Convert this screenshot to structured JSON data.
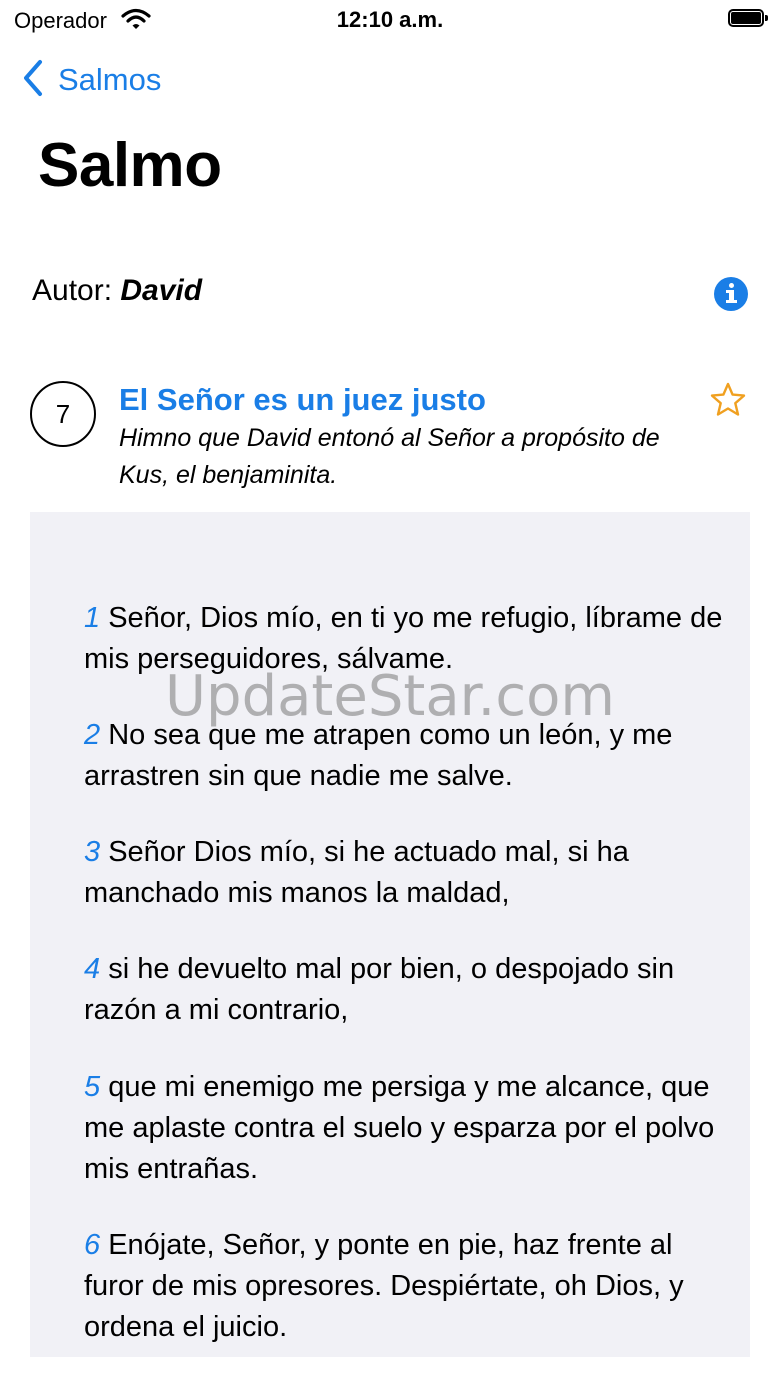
{
  "status_bar": {
    "carrier": "Operador",
    "time": "12:10 a.m."
  },
  "nav": {
    "back_label": "Salmos",
    "title": "Salmo"
  },
  "author": {
    "label": "Autor:",
    "name": "David"
  },
  "psalm": {
    "number": "7",
    "title": "El Señor es un juez justo",
    "subtitle": "Himno que David entonó al Señor a propósito de Kus, el benjaminita."
  },
  "verses": [
    {
      "num": "1",
      "text": "Señor, Dios mío, en ti yo me refugio, líbrame de mis perseguidores, sálvame."
    },
    {
      "num": "2",
      "text": "No sea que me atrapen como un león, y me arrastren sin que nadie me salve."
    },
    {
      "num": "3",
      "text": "Señor Dios mío, si he actuado mal, si ha manchado mis manos la maldad,"
    },
    {
      "num": "4",
      "text": "si he devuelto mal por bien, o despojado sin razón a mi contrario,"
    },
    {
      "num": "5",
      "text": "que mi enemigo me persiga y me alcance, que me aplaste contra el suelo y esparza por el polvo mis entrañas."
    },
    {
      "num": "6",
      "text": "Enójate, Señor, y ponte en pie, haz frente al furor de mis opresores. Despiértate, oh Dios, y ordena el juicio."
    }
  ],
  "watermark": "UpdateStar.com",
  "colors": {
    "accent": "#1a7ee6",
    "star": "#f0a020",
    "panel": "#f1f1f6"
  },
  "icons": {
    "back": "chevron-left-icon",
    "info": "info-icon",
    "favorite": "star-outline-icon",
    "wifi": "wifi-icon",
    "battery": "battery-icon"
  }
}
